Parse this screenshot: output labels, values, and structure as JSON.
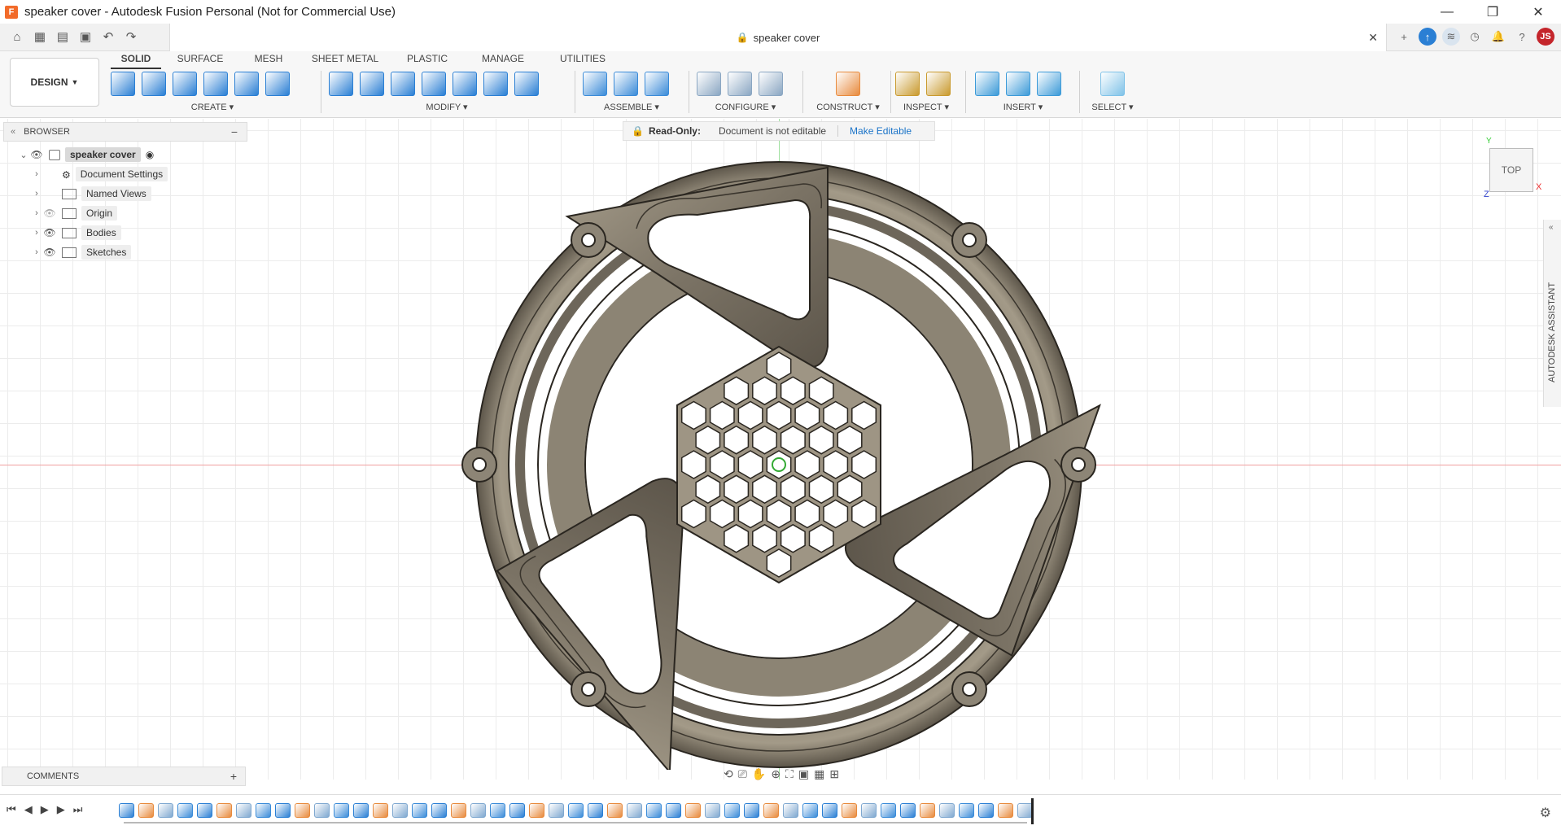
{
  "window": {
    "title": "speaker cover - Autodesk Fusion Personal (Not for Commercial Use)",
    "app_icon": "F",
    "controls": [
      "—",
      "❐",
      "✕"
    ]
  },
  "quick_access": [
    "⌂",
    "▦",
    "▤",
    "▣",
    "↶",
    "↷"
  ],
  "doc_tab": {
    "name": "speaker cover",
    "close": "✕",
    "lock_icon": "lock-icon"
  },
  "header_right": {
    "add": "+",
    "user_initials": "JS",
    "help": "?"
  },
  "toolbar": {
    "design_label": "DESIGN",
    "tabs": [
      "SOLID",
      "SURFACE",
      "MESH",
      "SHEET METAL",
      "PLASTIC",
      "MANAGE",
      "UTILITIES"
    ],
    "active_tab": "SOLID",
    "groups": [
      {
        "label": "CREATE",
        "icon_count": 6,
        "color": "#2a7fd4"
      },
      {
        "label": "MODIFY",
        "icon_count": 7,
        "color": "#2a7fd4"
      },
      {
        "label": "ASSEMBLE",
        "icon_count": 3,
        "color": "#3a8bd8"
      },
      {
        "label": "CONFIGURE",
        "icon_count": 3,
        "color": "#8aa6c2"
      },
      {
        "label": "CONSTRUCT",
        "icon_count": 1,
        "color": "#e88a3c"
      },
      {
        "label": "INSPECT",
        "icon_count": 2,
        "color": "#c99a2e"
      },
      {
        "label": "INSERT",
        "icon_count": 3,
        "color": "#3b9ad8"
      },
      {
        "label": "SELECT",
        "icon_count": 1,
        "color": "#7fc2e8"
      }
    ]
  },
  "browser": {
    "title": "BROWSER",
    "root": "speaker cover",
    "items": [
      {
        "label": "Document Settings",
        "icon": "gear-icon",
        "eye": false
      },
      {
        "label": "Named Views",
        "icon": "folder-icon",
        "eye": false
      },
      {
        "label": "Origin",
        "icon": "folder-icon",
        "eye": true,
        "hidden": true
      },
      {
        "label": "Bodies",
        "icon": "folder-icon",
        "eye": true
      },
      {
        "label": "Sketches",
        "icon": "folder-icon",
        "eye": true
      }
    ]
  },
  "readonly": {
    "title": "Read-Only:",
    "description": "Document is not editable",
    "link": "Make Editable"
  },
  "viewcube": {
    "face": "TOP",
    "x": "X",
    "y": "Y",
    "z": "Z"
  },
  "assistant": "AUTODESK ASSISTANT",
  "comments": {
    "title": "COMMENTS",
    "add": "+"
  },
  "timeline": {
    "controls": [
      "⏮",
      "◀",
      "▶",
      "▶",
      "⏭"
    ],
    "feature_count": 47
  },
  "colors": {
    "model_fill": "#7a7366",
    "model_light": "#b3aa99",
    "model_dark": "#4a443a",
    "link": "#1a73c8",
    "accent_red": "#c4252b"
  }
}
